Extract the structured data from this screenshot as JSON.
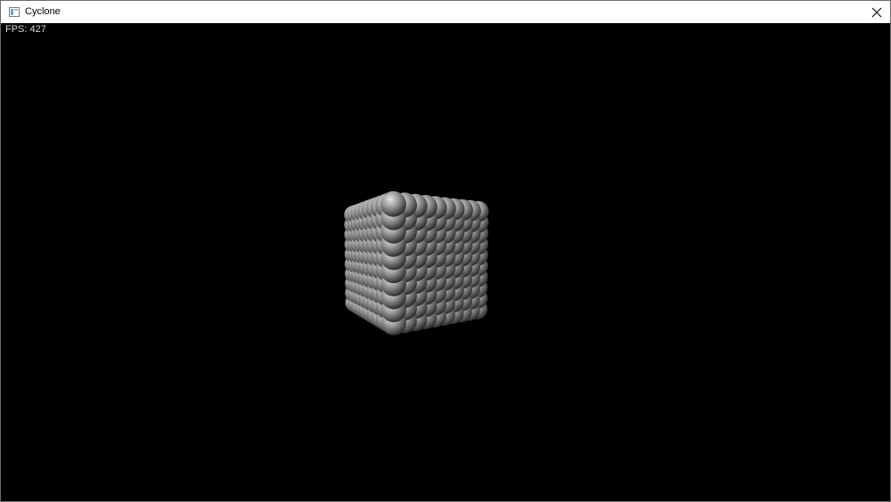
{
  "window": {
    "title": "Cyclone",
    "close_glyph": "close-icon"
  },
  "viewport": {
    "fps_text": "FPS: 427",
    "background": "#000000",
    "scene": {
      "description_icon": "particle-cube",
      "grid_size": 10,
      "sphere_color": "#9a9a9a",
      "highlight_color": "#e6e6e6",
      "shadow_color": "#2a2a2a"
    }
  }
}
